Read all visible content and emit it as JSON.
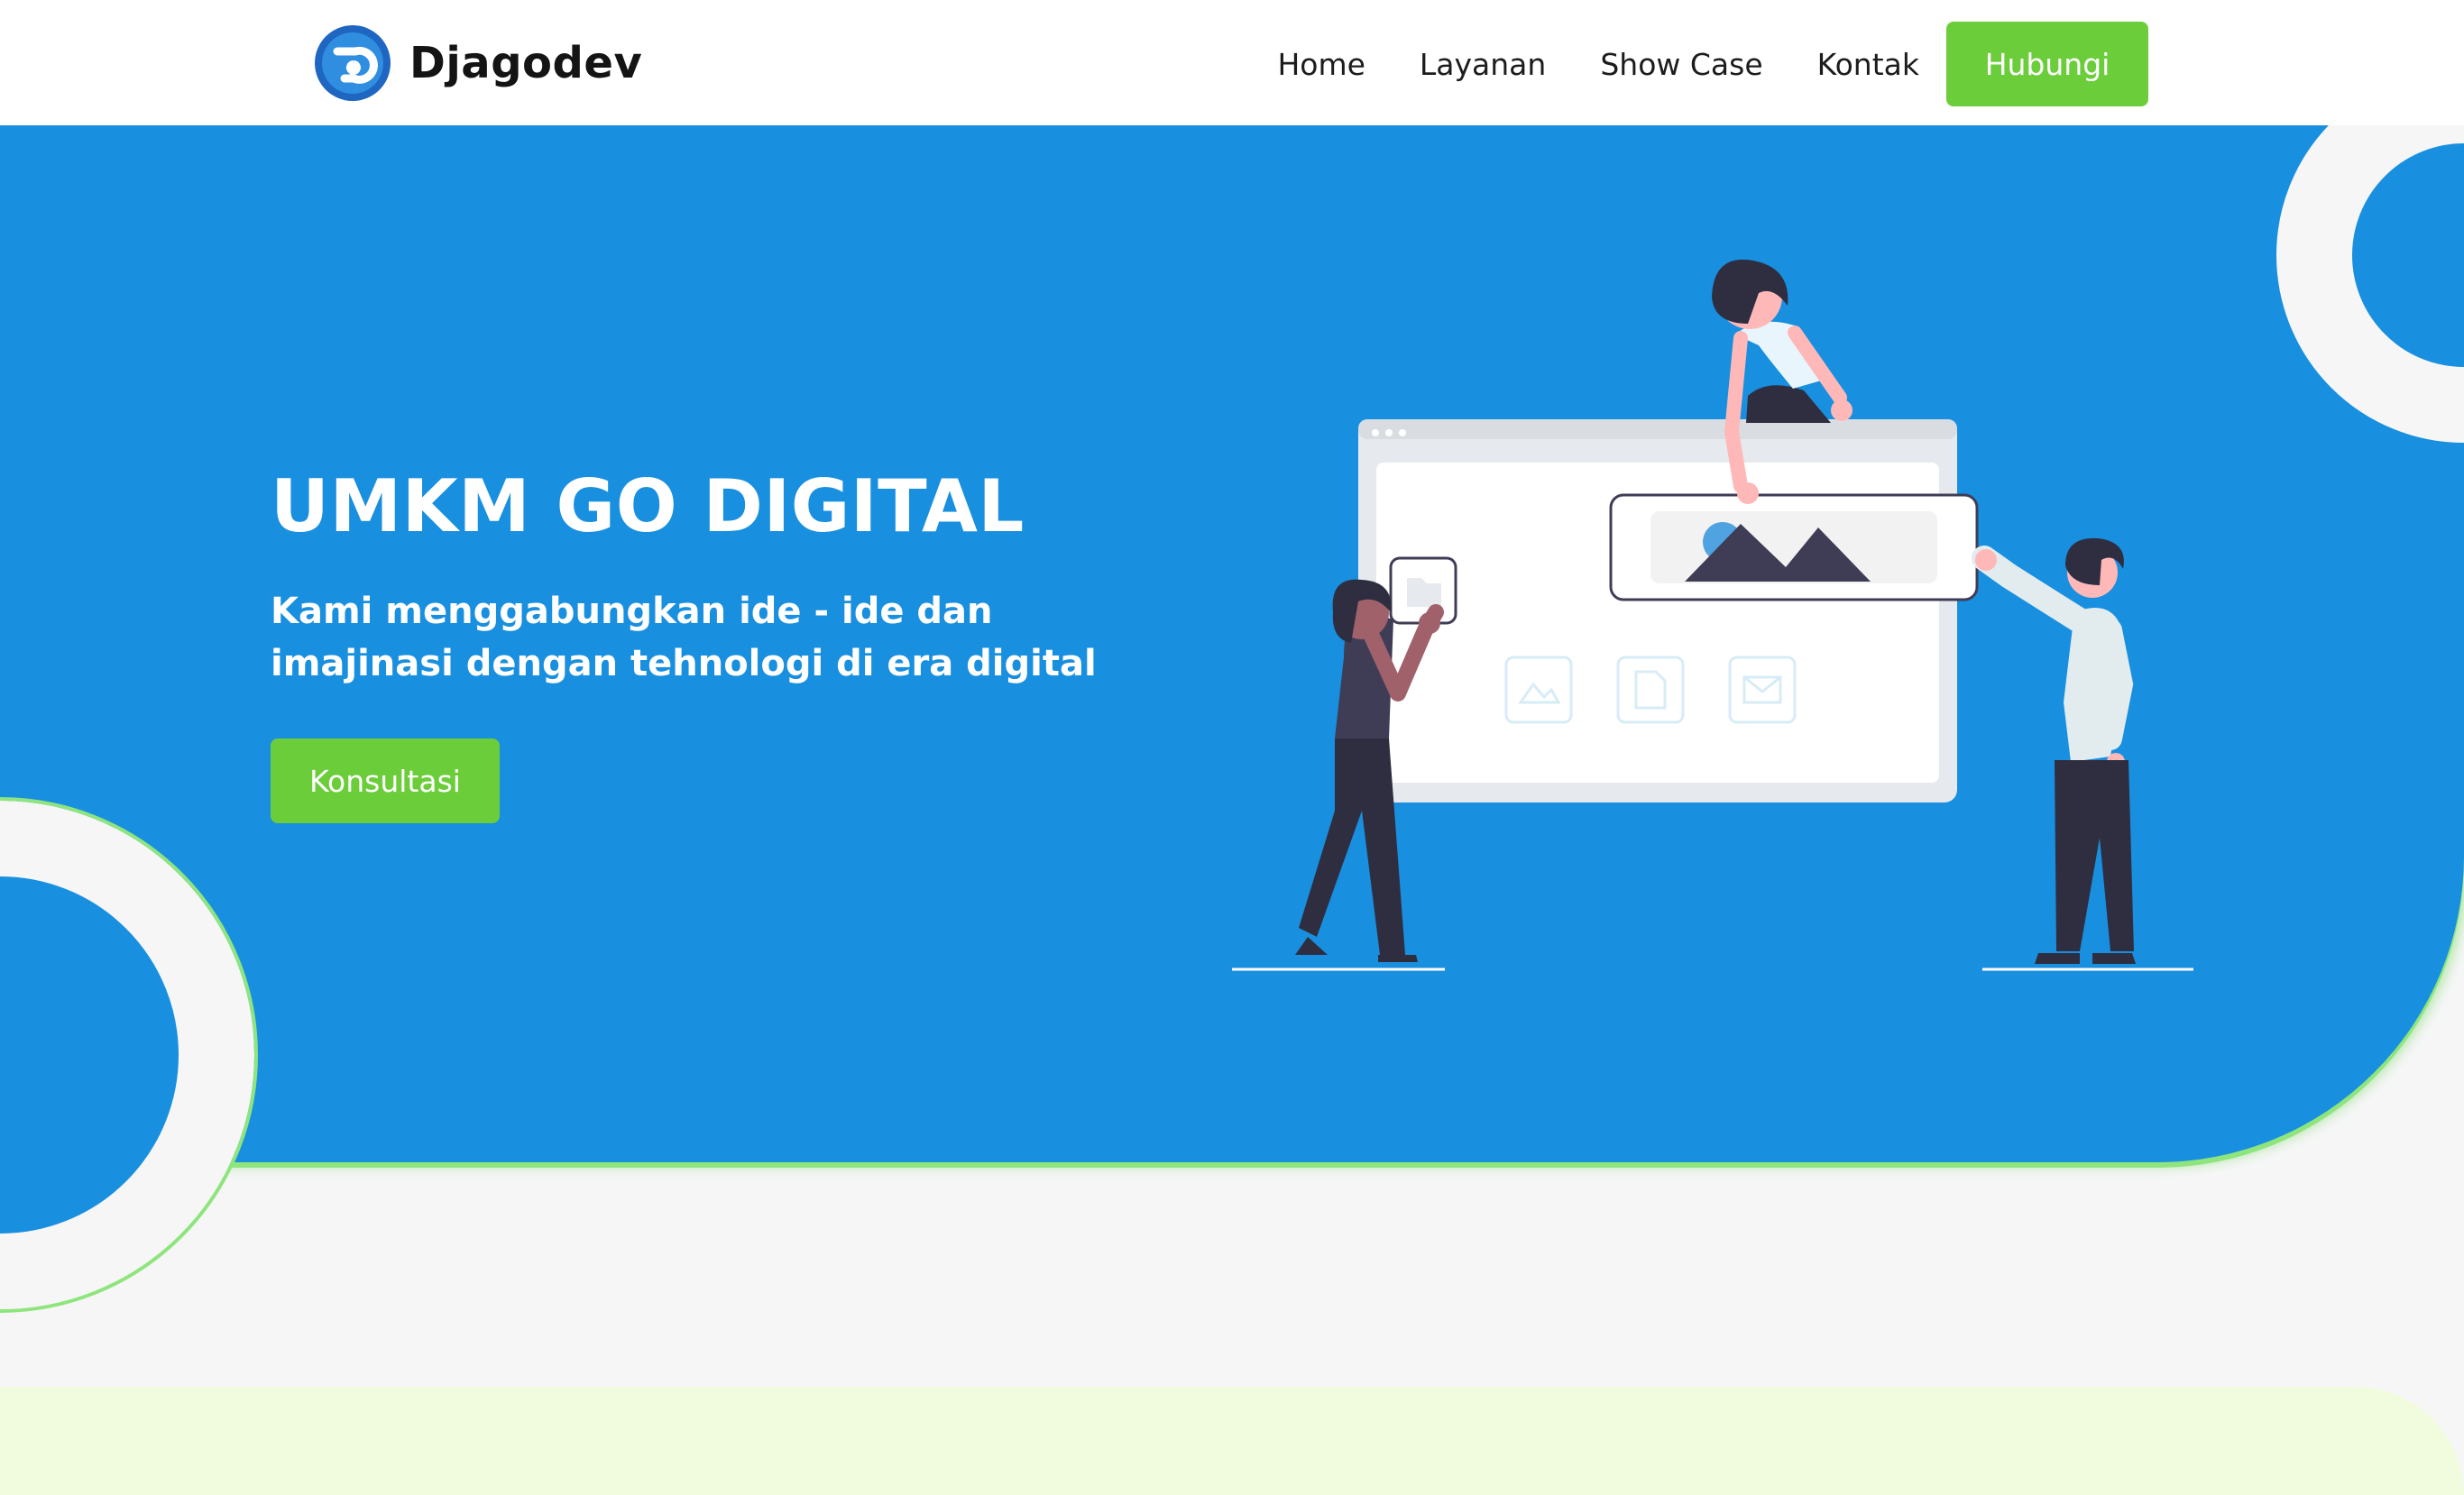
{
  "brand": {
    "name": "Djagodev"
  },
  "nav": {
    "links": [
      "Home",
      "Layanan",
      "Show Case",
      "Kontak"
    ],
    "cta": "Hubungi"
  },
  "hero": {
    "title": "UMKM GO DIGITAL",
    "description": "Kami menggabungkan ide - ide dan imajinasi dengan tehnologi di era digital",
    "cta": "Konsultasi"
  },
  "colors": {
    "primary_blue": "#198fdf",
    "accent_green": "#6ccd3b",
    "background": "#f6f6f7",
    "band": "#f1fcdf"
  }
}
